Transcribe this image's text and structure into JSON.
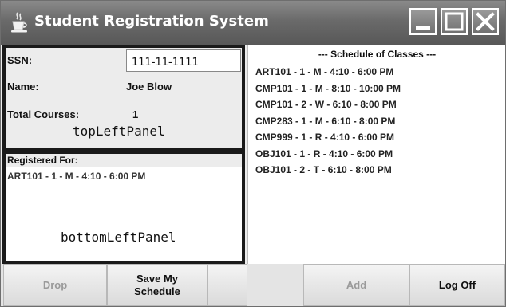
{
  "window": {
    "title": "Student Registration System"
  },
  "top_left_panel": {
    "ssn_label": "SSN:",
    "ssn_value": "111-11-1111",
    "name_label": "Name:",
    "name_value": "Joe Blow",
    "total_courses_label": "Total Courses:",
    "total_courses_value": "1",
    "panel_label": "topLeftPanel"
  },
  "bottom_left_panel": {
    "header": "Registered For:",
    "items": [
      "ART101 - 1 - M - 4:10 - 6:00 PM"
    ],
    "panel_label": "bottomLeftPanel"
  },
  "schedule": {
    "title": "--- Schedule of Classes ---",
    "items": [
      "ART101 - 1 - M - 4:10 - 6:00 PM",
      "CMP101 - 1 - M - 8:10 - 10:00 PM",
      "CMP101 - 2 - W - 6:10 - 8:00 PM",
      "CMP283 - 1 - M - 6:10 - 8:00 PM",
      "CMP999 - 1 - R - 4:10 - 6:00 PM",
      "OBJ101 - 1 - R - 4:10 - 6:00 PM",
      "OBJ101 - 2 - T - 6:10 - 8:00 PM"
    ]
  },
  "buttons": {
    "drop": "Drop",
    "save_line1": "Save My",
    "save_line2": "Schedule",
    "add": "Add",
    "log_off": "Log Off"
  },
  "icons": {
    "app": "coffee-cup-icon",
    "minimize": "minimize-icon",
    "maximize": "maximize-icon",
    "close": "close-icon"
  }
}
